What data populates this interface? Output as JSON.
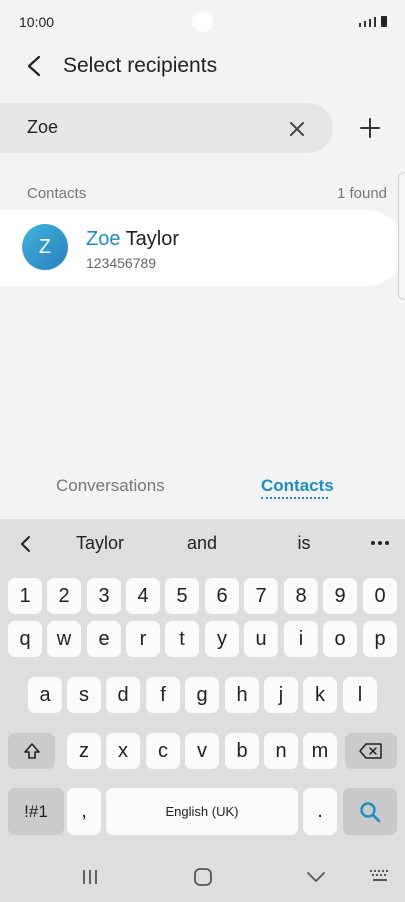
{
  "status_bar": {
    "time": "10:00"
  },
  "header": {
    "title": "Select recipients"
  },
  "search": {
    "value": "Zoe"
  },
  "contacts_section": {
    "label": "Contacts",
    "count": "1 found"
  },
  "contact": {
    "avatar_initial": "Z",
    "name_match": "Zoe",
    "name_rest": " Taylor",
    "number": "123456789"
  },
  "tabs": [
    {
      "label": "Conversations",
      "active": false
    },
    {
      "label": "Contacts",
      "active": true
    }
  ],
  "keyboard": {
    "suggestions": [
      "Taylor",
      "and",
      "is"
    ],
    "row_numbers": [
      "1",
      "2",
      "3",
      "4",
      "5",
      "6",
      "7",
      "8",
      "9",
      "0"
    ],
    "row_1": [
      "q",
      "w",
      "e",
      "r",
      "t",
      "y",
      "u",
      "i",
      "o",
      "p"
    ],
    "row_2": [
      "a",
      "s",
      "d",
      "f",
      "g",
      "h",
      "j",
      "k",
      "l"
    ],
    "row_3": [
      "z",
      "x",
      "c",
      "v",
      "b",
      "n",
      "m"
    ],
    "symbols_label": "!#1",
    "comma": ",",
    "space_label": "English (UK)",
    "period": "."
  },
  "colors": {
    "accent": "#1c8fc0",
    "background": "#f3f3f3",
    "keyboard": "#dedede"
  }
}
